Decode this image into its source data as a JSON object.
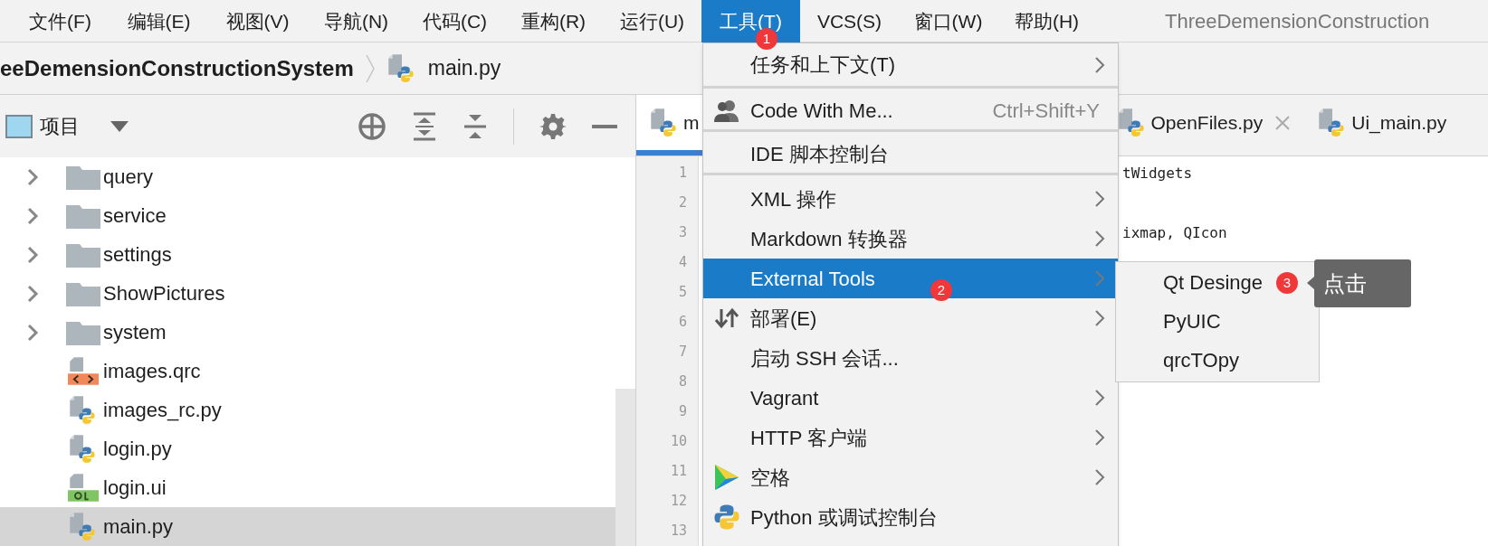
{
  "menu_bar": {
    "items": [
      {
        "label": "文件(F)",
        "selected": false
      },
      {
        "label": "编辑(E)",
        "selected": false
      },
      {
        "label": "视图(V)",
        "selected": false
      },
      {
        "label": "导航(N)",
        "selected": false
      },
      {
        "label": "代码(C)",
        "selected": false
      },
      {
        "label": "重构(R)",
        "selected": false
      },
      {
        "label": "运行(U)",
        "selected": false
      },
      {
        "label": "工具(T)",
        "selected": true,
        "badge": "1"
      },
      {
        "label": "VCS(S)",
        "selected": false
      },
      {
        "label": "窗口(W)",
        "selected": false
      },
      {
        "label": "帮助(H)",
        "selected": false
      }
    ],
    "title": "ThreeDemensionConstruction"
  },
  "breadcrumb": {
    "project": "eeDemensionConstructionSystem",
    "file": "main.py"
  },
  "project_panel": {
    "title": "项目",
    "tree": [
      {
        "label": "query",
        "kind": "folder",
        "expanded": false,
        "selected": false
      },
      {
        "label": "service",
        "kind": "folder",
        "expanded": false,
        "selected": false
      },
      {
        "label": "settings",
        "kind": "folder",
        "expanded": false,
        "selected": false
      },
      {
        "label": "ShowPictures",
        "kind": "folder",
        "expanded": false,
        "selected": false
      },
      {
        "label": "system",
        "kind": "folder",
        "expanded": false,
        "selected": false
      },
      {
        "label": "images.qrc",
        "kind": "qrc",
        "selected": false
      },
      {
        "label": "images_rc.py",
        "kind": "python",
        "selected": false
      },
      {
        "label": "login.py",
        "kind": "python",
        "selected": false
      },
      {
        "label": "login.ui",
        "kind": "ui",
        "selected": false
      },
      {
        "label": "main.py",
        "kind": "python",
        "selected": true
      }
    ]
  },
  "editor": {
    "tabs": [
      {
        "label": "m",
        "selected": true
      },
      {
        "label": "OpenFiles.py",
        "selected": false,
        "closable": true
      },
      {
        "label": "Ui_main.py",
        "selected": false
      }
    ],
    "lines": [
      {
        "number": "1",
        "code": "tWidgets"
      },
      {
        "number": "2"
      },
      {
        "number": "3",
        "code": "ixmap, QIcon"
      },
      {
        "number": "4"
      },
      {
        "number": "5"
      },
      {
        "number": "6"
      },
      {
        "number": "7"
      },
      {
        "number": "8"
      },
      {
        "number": "9"
      },
      {
        "number": "10"
      },
      {
        "number": "11"
      },
      {
        "number": "12"
      },
      {
        "number": "13"
      }
    ]
  },
  "tools_menu": {
    "items": [
      {
        "label": "任务和上下文(T)",
        "kind": "plain",
        "submenu": true,
        "selected": false,
        "separator_after": true
      },
      {
        "label": "Code With Me...",
        "kind": "people",
        "shortcut": "Ctrl+Shift+Y",
        "submenu": false,
        "selected": false,
        "separator_after": true
      },
      {
        "label": "IDE 脚本控制台",
        "kind": "plain",
        "submenu": false,
        "selected": false,
        "separator_after": true
      },
      {
        "label": "XML 操作",
        "kind": "plain",
        "submenu": true,
        "selected": false,
        "separator_after": false
      },
      {
        "label": "Markdown 转换器",
        "kind": "plain",
        "submenu": true,
        "selected": false,
        "separator_after": false
      },
      {
        "label": "External Tools",
        "kind": "plain",
        "submenu": true,
        "selected": true,
        "separator_after": false,
        "badge": "2"
      },
      {
        "label": "部署(E)",
        "kind": "deploy",
        "submenu": true,
        "selected": false,
        "separator_after": false
      },
      {
        "label": "启动 SSH 会话...",
        "kind": "plain",
        "submenu": false,
        "selected": false,
        "separator_after": false
      },
      {
        "label": "Vagrant",
        "kind": "plain",
        "submenu": true,
        "selected": false,
        "separator_after": false
      },
      {
        "label": "HTTP 客户端",
        "kind": "plain",
        "submenu": true,
        "selected": false,
        "separator_after": false
      },
      {
        "label": "空格",
        "kind": "space",
        "submenu": true,
        "selected": false,
        "separator_after": false
      },
      {
        "label": "Python 或调试控制台",
        "kind": "python",
        "submenu": false,
        "selected": false,
        "separator_after": false
      }
    ]
  },
  "external_tools_menu": {
    "items": [
      {
        "label": "Qt Desinge",
        "badge": "3",
        "tooltip": "点击"
      },
      {
        "label": "PyUIC"
      },
      {
        "label": "qrcTOpy"
      }
    ]
  }
}
